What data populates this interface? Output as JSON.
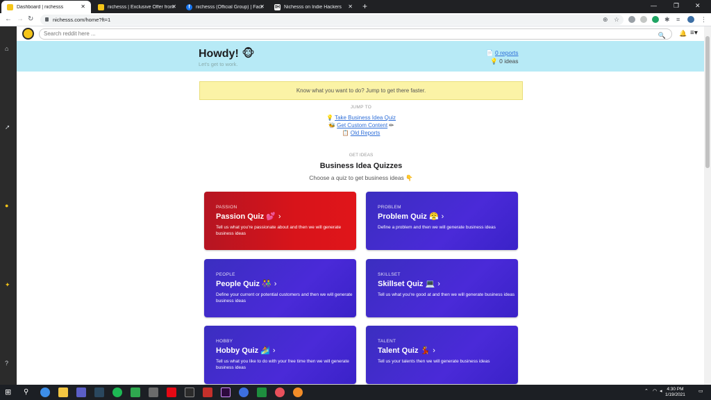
{
  "browser": {
    "tabs": [
      {
        "label": "Dashboard | nichesss",
        "active": true,
        "favicon": "nichesss-icon"
      },
      {
        "label": "nichesss | Exclusive Offer from Ap",
        "active": false,
        "favicon": "appsumo-icon"
      },
      {
        "label": "nichesss (Official Group) | Faceb",
        "active": false,
        "favicon": "facebook-icon"
      },
      {
        "label": "Nichesss on Indie Hackers",
        "active": false,
        "favicon": "indiehackers-icon"
      }
    ],
    "url": "nichesss.com/home?ft=1"
  },
  "app": {
    "search_placeholder": "Search reddit here ...",
    "hero": {
      "greeting": "Howdy!",
      "greeting_emoji": "🐵",
      "subtitle": "Let's get to work.",
      "reports_count": "0",
      "reports_label": "reports",
      "ideas_text": "0 ideas"
    },
    "banner": "Know what you want to do? Jump to get there faster.",
    "jump_to": {
      "heading": "JUMP TO",
      "links": [
        {
          "icon": "💡",
          "label": "Take Business Idea Quiz",
          "icon_after": ""
        },
        {
          "icon": "🐝",
          "label": "Get Custom Content",
          "icon_after": "✏"
        },
        {
          "icon": "📋",
          "label": "Old Reports",
          "icon_after": ""
        }
      ]
    },
    "get_ideas": {
      "heading": "GET IDEAS",
      "title": "Business Idea Quizzes",
      "subtitle": "Choose a quiz to get business ideas 👇"
    },
    "quizzes": [
      {
        "category": "PASSION",
        "title": "Passion Quiz",
        "emoji": "💕",
        "description": "Tell us what you're passionate about and then we will generate business ideas"
      },
      {
        "category": "PROBLEM",
        "title": "Problem Quiz",
        "emoji": "😤",
        "description": "Define a problem and then we will generate business ideas"
      },
      {
        "category": "PEOPLE",
        "title": "People Quiz",
        "emoji": "👫",
        "description": "Define your current or potential customers and then we will generate business ideas"
      },
      {
        "category": "SKILLSET",
        "title": "Skillset Quiz",
        "emoji": "💻",
        "description": "Tell us what you're good at and then we will generate business ideas"
      },
      {
        "category": "HOBBY",
        "title": "Hobby Quiz",
        "emoji": "🏄",
        "description": "Tell us what you like to do with your free time then we will generate business ideas"
      },
      {
        "category": "TALENT",
        "title": "Talent Quiz",
        "emoji": "💃",
        "description": "Tell us your talents then we will generate business ideas"
      }
    ]
  },
  "taskbar": {
    "time": "4:30 PM",
    "date": "1/19/2021"
  }
}
